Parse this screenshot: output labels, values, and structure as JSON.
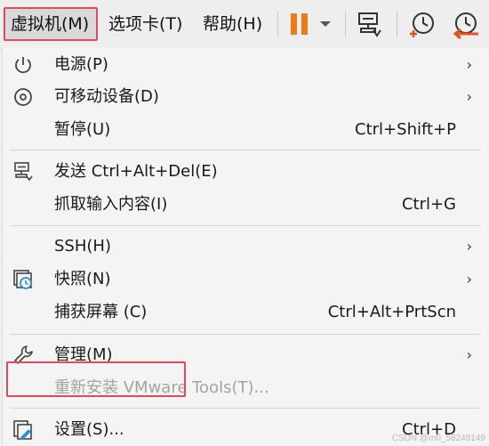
{
  "menubar": {
    "vm_label": "虚拟机(M)",
    "tabs_label": "选项卡(T)",
    "help_label": "帮助(H)"
  },
  "toolbar": {
    "icons": [
      "pause-icon",
      "dropdown-arrow-icon",
      "send-keys-icon",
      "snapshot-take-icon",
      "snapshot-revert-icon"
    ],
    "pause_color": "#f07a1a",
    "accent_color": "#e2541e"
  },
  "menu": {
    "items": [
      {
        "label": "电源(P)",
        "shortcut": "",
        "arrow": "›",
        "icon": "power-icon"
      },
      {
        "label": "可移动设备(D)",
        "shortcut": "",
        "arrow": "›",
        "icon": "removable-device-icon"
      },
      {
        "label": "暂停(U)",
        "shortcut": "Ctrl+Shift+P",
        "arrow": ""
      },
      {
        "label": "发送 Ctrl+Alt+Del(E)",
        "shortcut": "",
        "arrow": "",
        "icon": "send-keys-icon"
      },
      {
        "label": "抓取输入内容(I)",
        "shortcut": "Ctrl+G",
        "arrow": ""
      },
      {
        "label": "SSH(H)",
        "shortcut": "",
        "arrow": "›"
      },
      {
        "label": "快照(N)",
        "shortcut": "",
        "arrow": "›",
        "icon": "snapshot-icon"
      },
      {
        "label": "捕获屏幕 (C)",
        "shortcut": "Ctrl+Alt+PrtScn",
        "arrow": ""
      },
      {
        "label": "管理(M)",
        "shortcut": "",
        "arrow": "›",
        "icon": "wrench-icon"
      },
      {
        "label": "重新安装 VMware Tools(T)...",
        "shortcut": "",
        "arrow": "",
        "disabled": true
      },
      {
        "label": "设置(S)...",
        "shortcut": "Ctrl+D",
        "arrow": "",
        "icon": "settings-icon"
      }
    ]
  },
  "colors": {
    "highlight_border": "#e24a5a",
    "icon_blue": "#2a8fd6"
  },
  "watermark": "CSDN @m0_58248149"
}
